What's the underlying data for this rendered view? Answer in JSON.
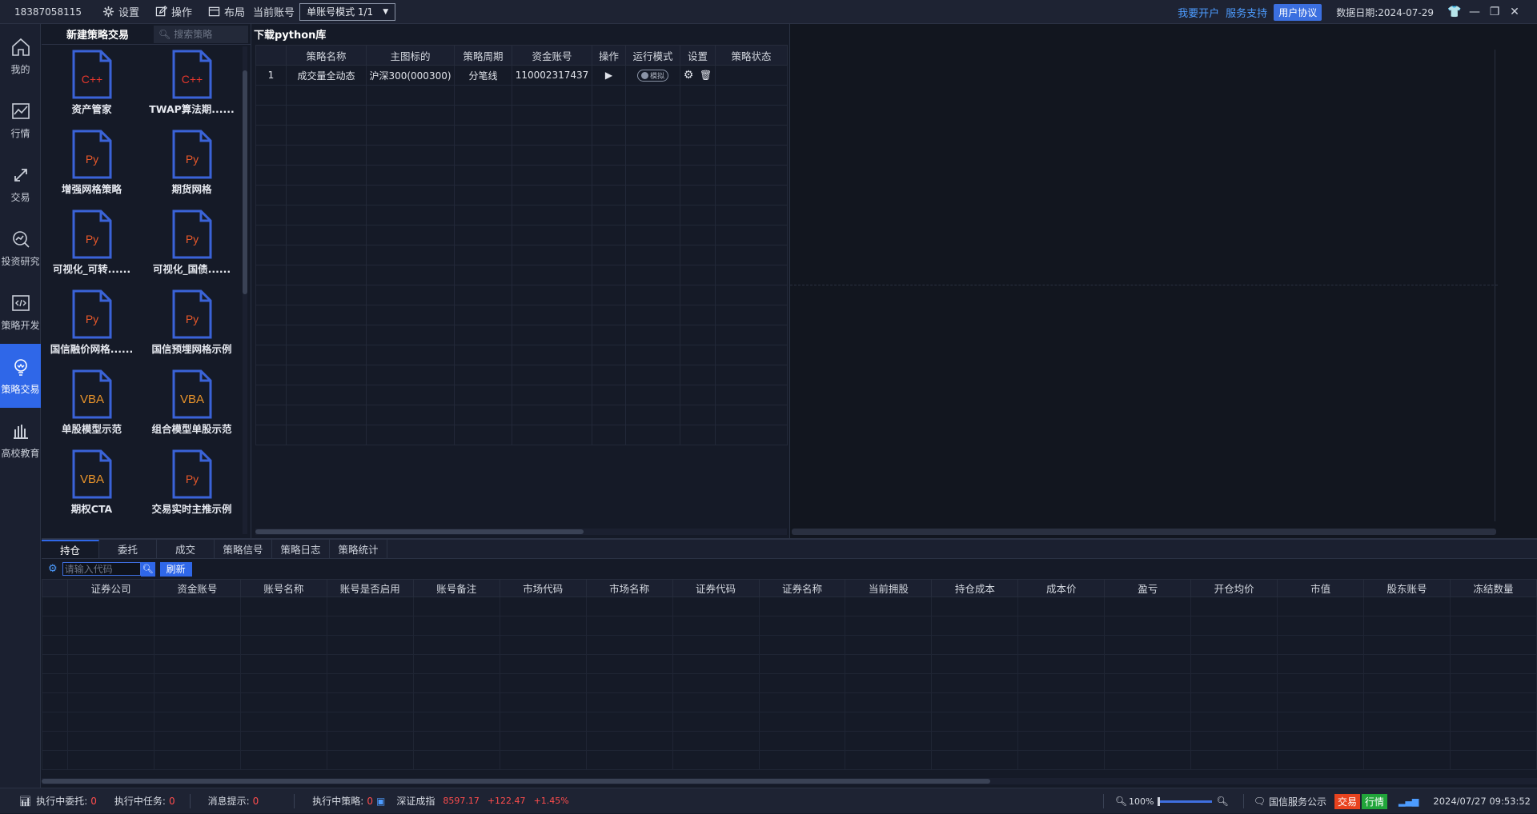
{
  "titlebar": {
    "account_id": "18387058115",
    "menus": [
      {
        "label": "设置",
        "icon": "gear-icon"
      },
      {
        "label": "操作",
        "icon": "edit-icon"
      },
      {
        "label": "布局",
        "icon": "layout-icon"
      }
    ],
    "current_account_label": "当前账号",
    "mode_select": "单账号模式 1/1",
    "links": [
      "我要开户",
      "服务支持"
    ],
    "agreement": "用户协议",
    "date_label": "数据日期:2024-07-29"
  },
  "leftnav": {
    "items": [
      {
        "label": "我的",
        "icon": "home-icon"
      },
      {
        "label": "行情",
        "icon": "market-chart-icon"
      },
      {
        "label": "交易",
        "icon": "trade-arrows-icon"
      },
      {
        "label": "投资研究",
        "icon": "research-icon"
      },
      {
        "label": "策略开发",
        "icon": "code-icon"
      },
      {
        "label": "策略交易",
        "icon": "bulb-icon"
      },
      {
        "label": "高校教育",
        "icon": "education-icon"
      }
    ],
    "active_index": 5
  },
  "strategy_panel": {
    "title": "新建策略交易",
    "search_placeholder": "搜索策略",
    "tiles": [
      {
        "label": "资产管家",
        "type": "C++",
        "color": "#e8372c"
      },
      {
        "label": "TWAP算法期......",
        "type": "C++",
        "color": "#e8372c"
      },
      {
        "label": "增强网格策略",
        "type": "Py",
        "color": "#e8582a"
      },
      {
        "label": "期货网格",
        "type": "Py",
        "color": "#e8582a"
      },
      {
        "label": "可视化_可转......",
        "type": "Py",
        "color": "#e8582a"
      },
      {
        "label": "可视化_国债......",
        "type": "Py",
        "color": "#e8582a"
      },
      {
        "label": "国信融价网格......",
        "type": "Py",
        "color": "#e8582a"
      },
      {
        "label": "国信预埋网格示例",
        "type": "Py",
        "color": "#e8582a"
      },
      {
        "label": "单股模型示范",
        "type": "VBA",
        "color": "#e8932a"
      },
      {
        "label": "组合模型单股示范",
        "type": "VBA",
        "color": "#e8932a"
      },
      {
        "label": "期权CTA",
        "type": "VBA",
        "color": "#e8932a"
      },
      {
        "label": "交易实时主推示例",
        "type": "Py",
        "color": "#e8582a"
      }
    ]
  },
  "middle": {
    "title": "下载python库",
    "columns": [
      "",
      "策略名称",
      "主图标的",
      "策略周期",
      "资金账号",
      "操作",
      "运行模式",
      "设置",
      "策略状态"
    ],
    "rows": [
      {
        "index": "1",
        "name": "成交量全动态",
        "target": "沪深300(000300)",
        "period": "分笔线",
        "account": "110002317437",
        "mode": "模拟",
        "status": ""
      }
    ]
  },
  "bottom": {
    "tabs": [
      "持仓",
      "委托",
      "成交",
      "策略信号",
      "策略日志",
      "策略统计"
    ],
    "active_tab": 0,
    "code_placeholder": "请输入代码",
    "refresh": "刷新",
    "columns": [
      "证券公司",
      "资金账号",
      "账号名称",
      "账号是否启用",
      "账号备注",
      "市场代码",
      "市场名称",
      "证券代码",
      "证券名称",
      "当前拥股",
      "持仓成本",
      "成本价",
      "盈亏",
      "开仓均价",
      "市值",
      "股东账号",
      "冻结数量"
    ]
  },
  "status": {
    "exec_orders_label": "执行中委托:",
    "exec_orders": "0",
    "exec_tasks_label": "执行中任务:",
    "exec_tasks": "0",
    "messages_label": "消息提示:",
    "messages": "0",
    "exec_strategies_label": "执行中策略:",
    "exec_strategies": "0",
    "index_name": "深证成指",
    "index_value": "8597.17",
    "index_change": "+122.47",
    "index_pct": "+1.45%",
    "zoom": "100%",
    "service": "国信服务公示",
    "trade_pill": "交易",
    "market_pill": "行情",
    "datetime": "2024/07/27 09:53:52"
  }
}
